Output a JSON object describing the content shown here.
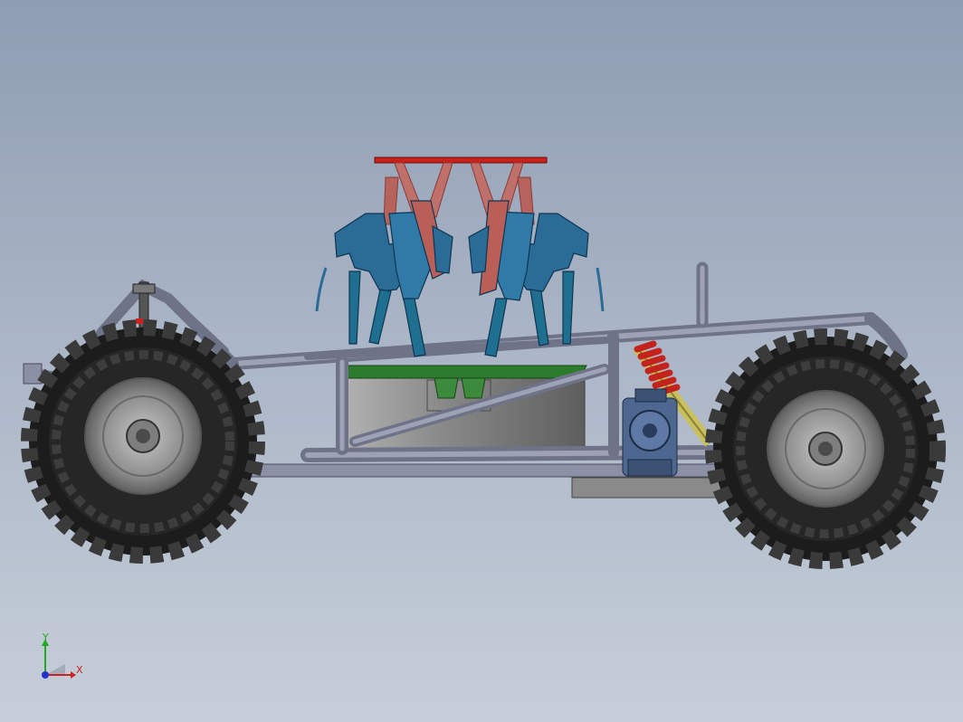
{
  "viewport": {
    "background_top": "#8e9db2",
    "background_bottom": "#c6ced9"
  },
  "model": {
    "parts": [
      "front-wheel",
      "rear-wheel",
      "tubular-frame",
      "battery-box",
      "parallel-platform",
      "actuator-legs",
      "motor-gearbox",
      "coilover-shock",
      "skid-plate",
      "tow-hitch"
    ],
    "colors": {
      "frame": "#868aa0",
      "tire": "#1c1c1c",
      "rim": "#9a9a9a",
      "platform_top": "#c8201a",
      "upper_legs": "#c0706a",
      "lower_legs": "#1f6f90",
      "actuator_body": "#2a6c95",
      "mount_plate": "#2c7a2c",
      "battery_box": "#7e7e7e",
      "spring": "#c4221c",
      "shock_body": "#c8c060",
      "motor": "#4d6791",
      "skid_plate": "#8a8a8a"
    }
  },
  "triad": {
    "x_label": "X",
    "y_label": "Y",
    "x_color": "#cc2222",
    "y_color": "#22aa22",
    "z_color": "#2233cc"
  }
}
